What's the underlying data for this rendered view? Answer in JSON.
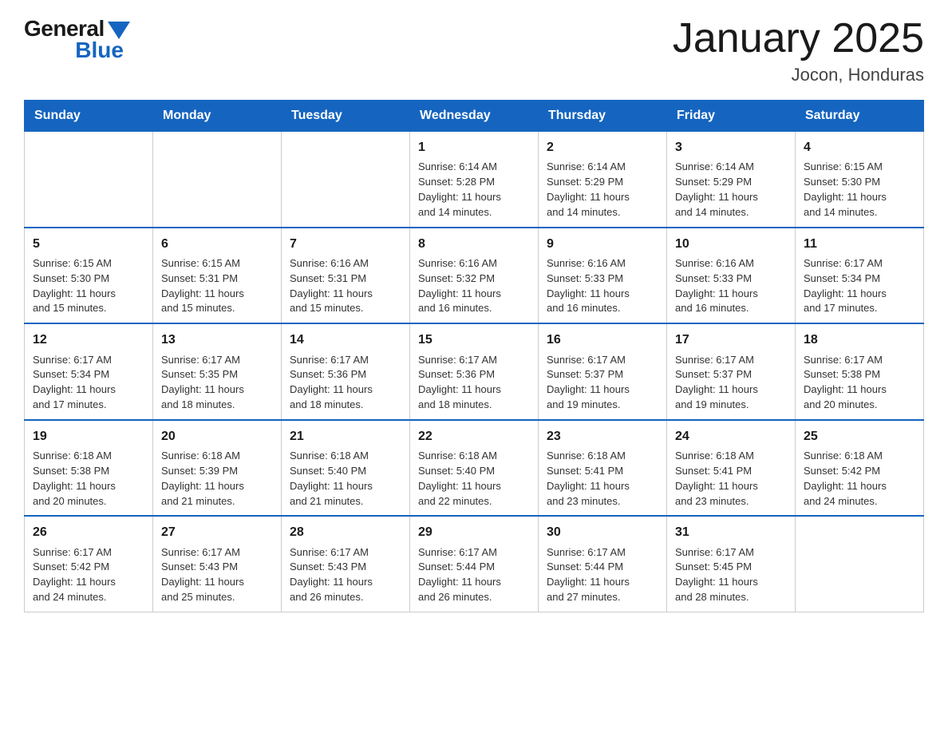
{
  "logo": {
    "general": "General",
    "blue": "Blue"
  },
  "title": "January 2025",
  "subtitle": "Jocon, Honduras",
  "days_of_week": [
    "Sunday",
    "Monday",
    "Tuesday",
    "Wednesday",
    "Thursday",
    "Friday",
    "Saturday"
  ],
  "weeks": [
    [
      {
        "day": "",
        "info": ""
      },
      {
        "day": "",
        "info": ""
      },
      {
        "day": "",
        "info": ""
      },
      {
        "day": "1",
        "info": "Sunrise: 6:14 AM\nSunset: 5:28 PM\nDaylight: 11 hours\nand 14 minutes."
      },
      {
        "day": "2",
        "info": "Sunrise: 6:14 AM\nSunset: 5:29 PM\nDaylight: 11 hours\nand 14 minutes."
      },
      {
        "day": "3",
        "info": "Sunrise: 6:14 AM\nSunset: 5:29 PM\nDaylight: 11 hours\nand 14 minutes."
      },
      {
        "day": "4",
        "info": "Sunrise: 6:15 AM\nSunset: 5:30 PM\nDaylight: 11 hours\nand 14 minutes."
      }
    ],
    [
      {
        "day": "5",
        "info": "Sunrise: 6:15 AM\nSunset: 5:30 PM\nDaylight: 11 hours\nand 15 minutes."
      },
      {
        "day": "6",
        "info": "Sunrise: 6:15 AM\nSunset: 5:31 PM\nDaylight: 11 hours\nand 15 minutes."
      },
      {
        "day": "7",
        "info": "Sunrise: 6:16 AM\nSunset: 5:31 PM\nDaylight: 11 hours\nand 15 minutes."
      },
      {
        "day": "8",
        "info": "Sunrise: 6:16 AM\nSunset: 5:32 PM\nDaylight: 11 hours\nand 16 minutes."
      },
      {
        "day": "9",
        "info": "Sunrise: 6:16 AM\nSunset: 5:33 PM\nDaylight: 11 hours\nand 16 minutes."
      },
      {
        "day": "10",
        "info": "Sunrise: 6:16 AM\nSunset: 5:33 PM\nDaylight: 11 hours\nand 16 minutes."
      },
      {
        "day": "11",
        "info": "Sunrise: 6:17 AM\nSunset: 5:34 PM\nDaylight: 11 hours\nand 17 minutes."
      }
    ],
    [
      {
        "day": "12",
        "info": "Sunrise: 6:17 AM\nSunset: 5:34 PM\nDaylight: 11 hours\nand 17 minutes."
      },
      {
        "day": "13",
        "info": "Sunrise: 6:17 AM\nSunset: 5:35 PM\nDaylight: 11 hours\nand 18 minutes."
      },
      {
        "day": "14",
        "info": "Sunrise: 6:17 AM\nSunset: 5:36 PM\nDaylight: 11 hours\nand 18 minutes."
      },
      {
        "day": "15",
        "info": "Sunrise: 6:17 AM\nSunset: 5:36 PM\nDaylight: 11 hours\nand 18 minutes."
      },
      {
        "day": "16",
        "info": "Sunrise: 6:17 AM\nSunset: 5:37 PM\nDaylight: 11 hours\nand 19 minutes."
      },
      {
        "day": "17",
        "info": "Sunrise: 6:17 AM\nSunset: 5:37 PM\nDaylight: 11 hours\nand 19 minutes."
      },
      {
        "day": "18",
        "info": "Sunrise: 6:17 AM\nSunset: 5:38 PM\nDaylight: 11 hours\nand 20 minutes."
      }
    ],
    [
      {
        "day": "19",
        "info": "Sunrise: 6:18 AM\nSunset: 5:38 PM\nDaylight: 11 hours\nand 20 minutes."
      },
      {
        "day": "20",
        "info": "Sunrise: 6:18 AM\nSunset: 5:39 PM\nDaylight: 11 hours\nand 21 minutes."
      },
      {
        "day": "21",
        "info": "Sunrise: 6:18 AM\nSunset: 5:40 PM\nDaylight: 11 hours\nand 21 minutes."
      },
      {
        "day": "22",
        "info": "Sunrise: 6:18 AM\nSunset: 5:40 PM\nDaylight: 11 hours\nand 22 minutes."
      },
      {
        "day": "23",
        "info": "Sunrise: 6:18 AM\nSunset: 5:41 PM\nDaylight: 11 hours\nand 23 minutes."
      },
      {
        "day": "24",
        "info": "Sunrise: 6:18 AM\nSunset: 5:41 PM\nDaylight: 11 hours\nand 23 minutes."
      },
      {
        "day": "25",
        "info": "Sunrise: 6:18 AM\nSunset: 5:42 PM\nDaylight: 11 hours\nand 24 minutes."
      }
    ],
    [
      {
        "day": "26",
        "info": "Sunrise: 6:17 AM\nSunset: 5:42 PM\nDaylight: 11 hours\nand 24 minutes."
      },
      {
        "day": "27",
        "info": "Sunrise: 6:17 AM\nSunset: 5:43 PM\nDaylight: 11 hours\nand 25 minutes."
      },
      {
        "day": "28",
        "info": "Sunrise: 6:17 AM\nSunset: 5:43 PM\nDaylight: 11 hours\nand 26 minutes."
      },
      {
        "day": "29",
        "info": "Sunrise: 6:17 AM\nSunset: 5:44 PM\nDaylight: 11 hours\nand 26 minutes."
      },
      {
        "day": "30",
        "info": "Sunrise: 6:17 AM\nSunset: 5:44 PM\nDaylight: 11 hours\nand 27 minutes."
      },
      {
        "day": "31",
        "info": "Sunrise: 6:17 AM\nSunset: 5:45 PM\nDaylight: 11 hours\nand 28 minutes."
      },
      {
        "day": "",
        "info": ""
      }
    ]
  ]
}
